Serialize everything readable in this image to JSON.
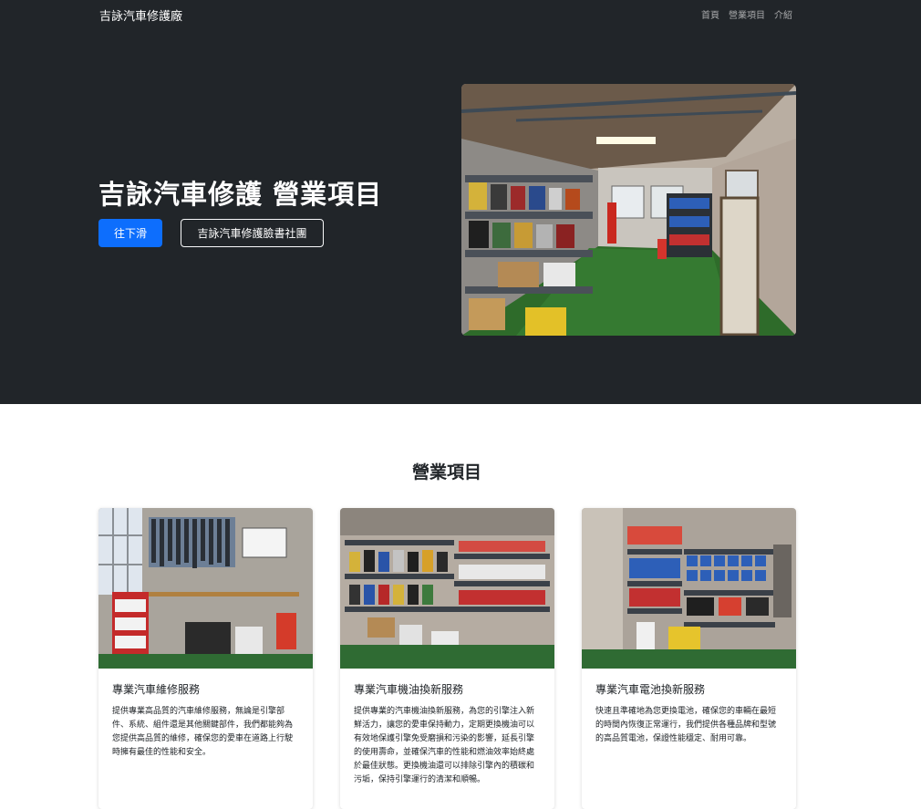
{
  "navbar": {
    "brand": "吉詠汽車修護廠",
    "links": [
      "首頁",
      "營業項目",
      "介紹"
    ]
  },
  "hero": {
    "title": "吉詠汽車修護 營業項目",
    "primary_button": "往下滑",
    "secondary_button": "吉詠汽車修護臉書社團"
  },
  "services": {
    "heading": "營業項目",
    "cards": [
      {
        "title": "專業汽車維修服務",
        "text": "提供專業高品質的汽車維修服務，無論是引擎部件、系統、組件還是其他關鍵部件，我們都能夠為您提供高品質的維修，確保您的愛車在道路上行駛時擁有最佳的性能和安全。"
      },
      {
        "title": "專業汽車機油換新服務",
        "text": "提供專業的汽車機油換新服務，為您的引擎注入新鮮活力，讓您的愛車保持動力，定期更換機油可以有效地保護引擎免受磨損和污染的影響，延長引擎的使用壽命，並確保汽車的性能和燃油效率始終處於最佳狀態。更換機油還可以排除引擎內的積碳和污垢，保持引擎運行的清潔和順暢。"
      },
      {
        "title": "專業汽車電池換新服務",
        "text": "快速且準確地為您更換電池，確保您的車輛在最短的時間內恢復正常運行，我們提供各種品牌和型號的高品質電池，保證性能穩定、耐用可靠。"
      }
    ]
  },
  "colors": {
    "dark": "#212529",
    "primary": "#0d6efd",
    "garage_floor": "#2e6b2a"
  }
}
